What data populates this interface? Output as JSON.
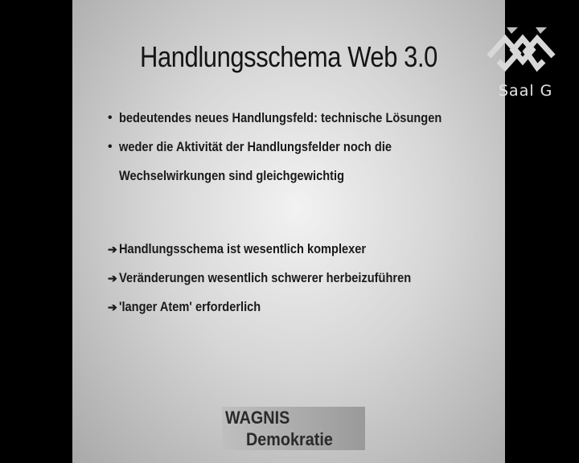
{
  "slide": {
    "title": "Handlungsschema Web 3.0",
    "bullets_top": [
      {
        "marker": "•",
        "text": "bedeutendes neues Handlungsfeld: technische Lösungen"
      },
      {
        "marker": "•",
        "text": "weder die Aktivität der Handlungsfelder noch die"
      },
      {
        "marker": "",
        "text": "Wechselwirkungen sind gleichgewichtig"
      }
    ],
    "bullets_bottom": [
      {
        "marker": "➔",
        "text": "Handlungsschema ist wesentlich komplexer"
      },
      {
        "marker": "➔",
        "text": "Veränderungen wesentlich schwerer herbeizuführen"
      },
      {
        "marker": "➔",
        "text": "'langer Atem' erforderlich"
      }
    ],
    "logo": {
      "line1": "WAGNIS",
      "line2": "Demokratie"
    }
  },
  "overlay": {
    "room_label": "Saal G",
    "room_logo_icon": "room-logo-icon"
  }
}
